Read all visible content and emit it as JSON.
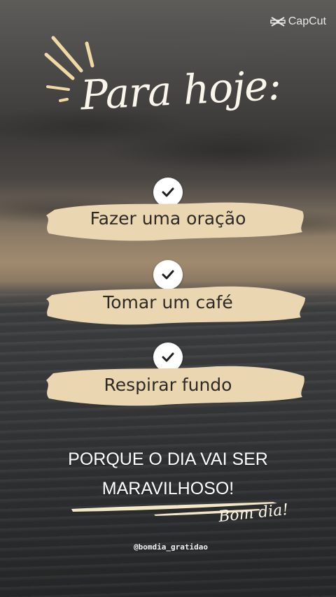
{
  "watermark": {
    "brand": "CapCut",
    "icon": "capcut-logo-icon"
  },
  "title": "Para hoje:",
  "checklist": [
    {
      "label": "Fazer uma oração",
      "icon": "check-icon"
    },
    {
      "label": "Tomar um café",
      "icon": "check-icon"
    },
    {
      "label": "Respirar fundo",
      "icon": "check-icon"
    }
  ],
  "closing": {
    "line1": "PORQUE O DIA VAI SER",
    "line2": "MARAVILHOSO!"
  },
  "signature": "Bom dia!",
  "handle": "@bomdia_gratidao",
  "colors": {
    "brush": "#ead6b0",
    "check_bg": "#ffffff",
    "check_mark": "#1f1f1f",
    "text_light": "#fbf6ec"
  }
}
